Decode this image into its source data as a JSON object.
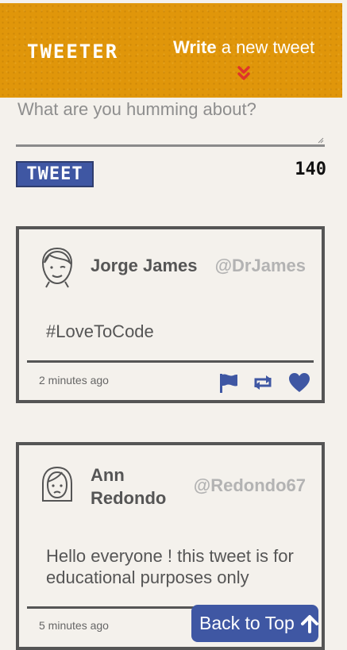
{
  "header": {
    "brand": "TWEETER",
    "write_bold": "Write",
    "write_rest": " a new tweet",
    "chevron_icon": "double-chevron-down-icon"
  },
  "composer": {
    "placeholder": "What are you humming about?",
    "value": "",
    "submit_label": "TWEET",
    "char_count": "140"
  },
  "tweets": [
    {
      "name": "Jorge James",
      "handle": "@DrJames",
      "text": "#LoveToCode",
      "time": "2 minutes ago",
      "avatar": "male-avatar-icon",
      "actions": [
        "flag-icon",
        "retweet-icon",
        "heart-icon"
      ]
    },
    {
      "name": "Ann Redondo",
      "handle": "@Redondo67",
      "text": "Hello everyone ! this tweet is for educational purposes only",
      "time": "5 minutes ago",
      "avatar": "female-avatar-icon",
      "actions": [
        "flag-icon",
        "retweet-icon",
        "heart-icon"
      ]
    }
  ],
  "back_to_top": {
    "label": "Back to Top",
    "icon": "arrow-up-icon"
  },
  "colors": {
    "header_bg": "#e0960a",
    "accent_blue": "#3f57a3",
    "chevron_red": "#e0342a",
    "page_bg": "#f4f1ec",
    "handle_gray": "#b3b3b3"
  }
}
